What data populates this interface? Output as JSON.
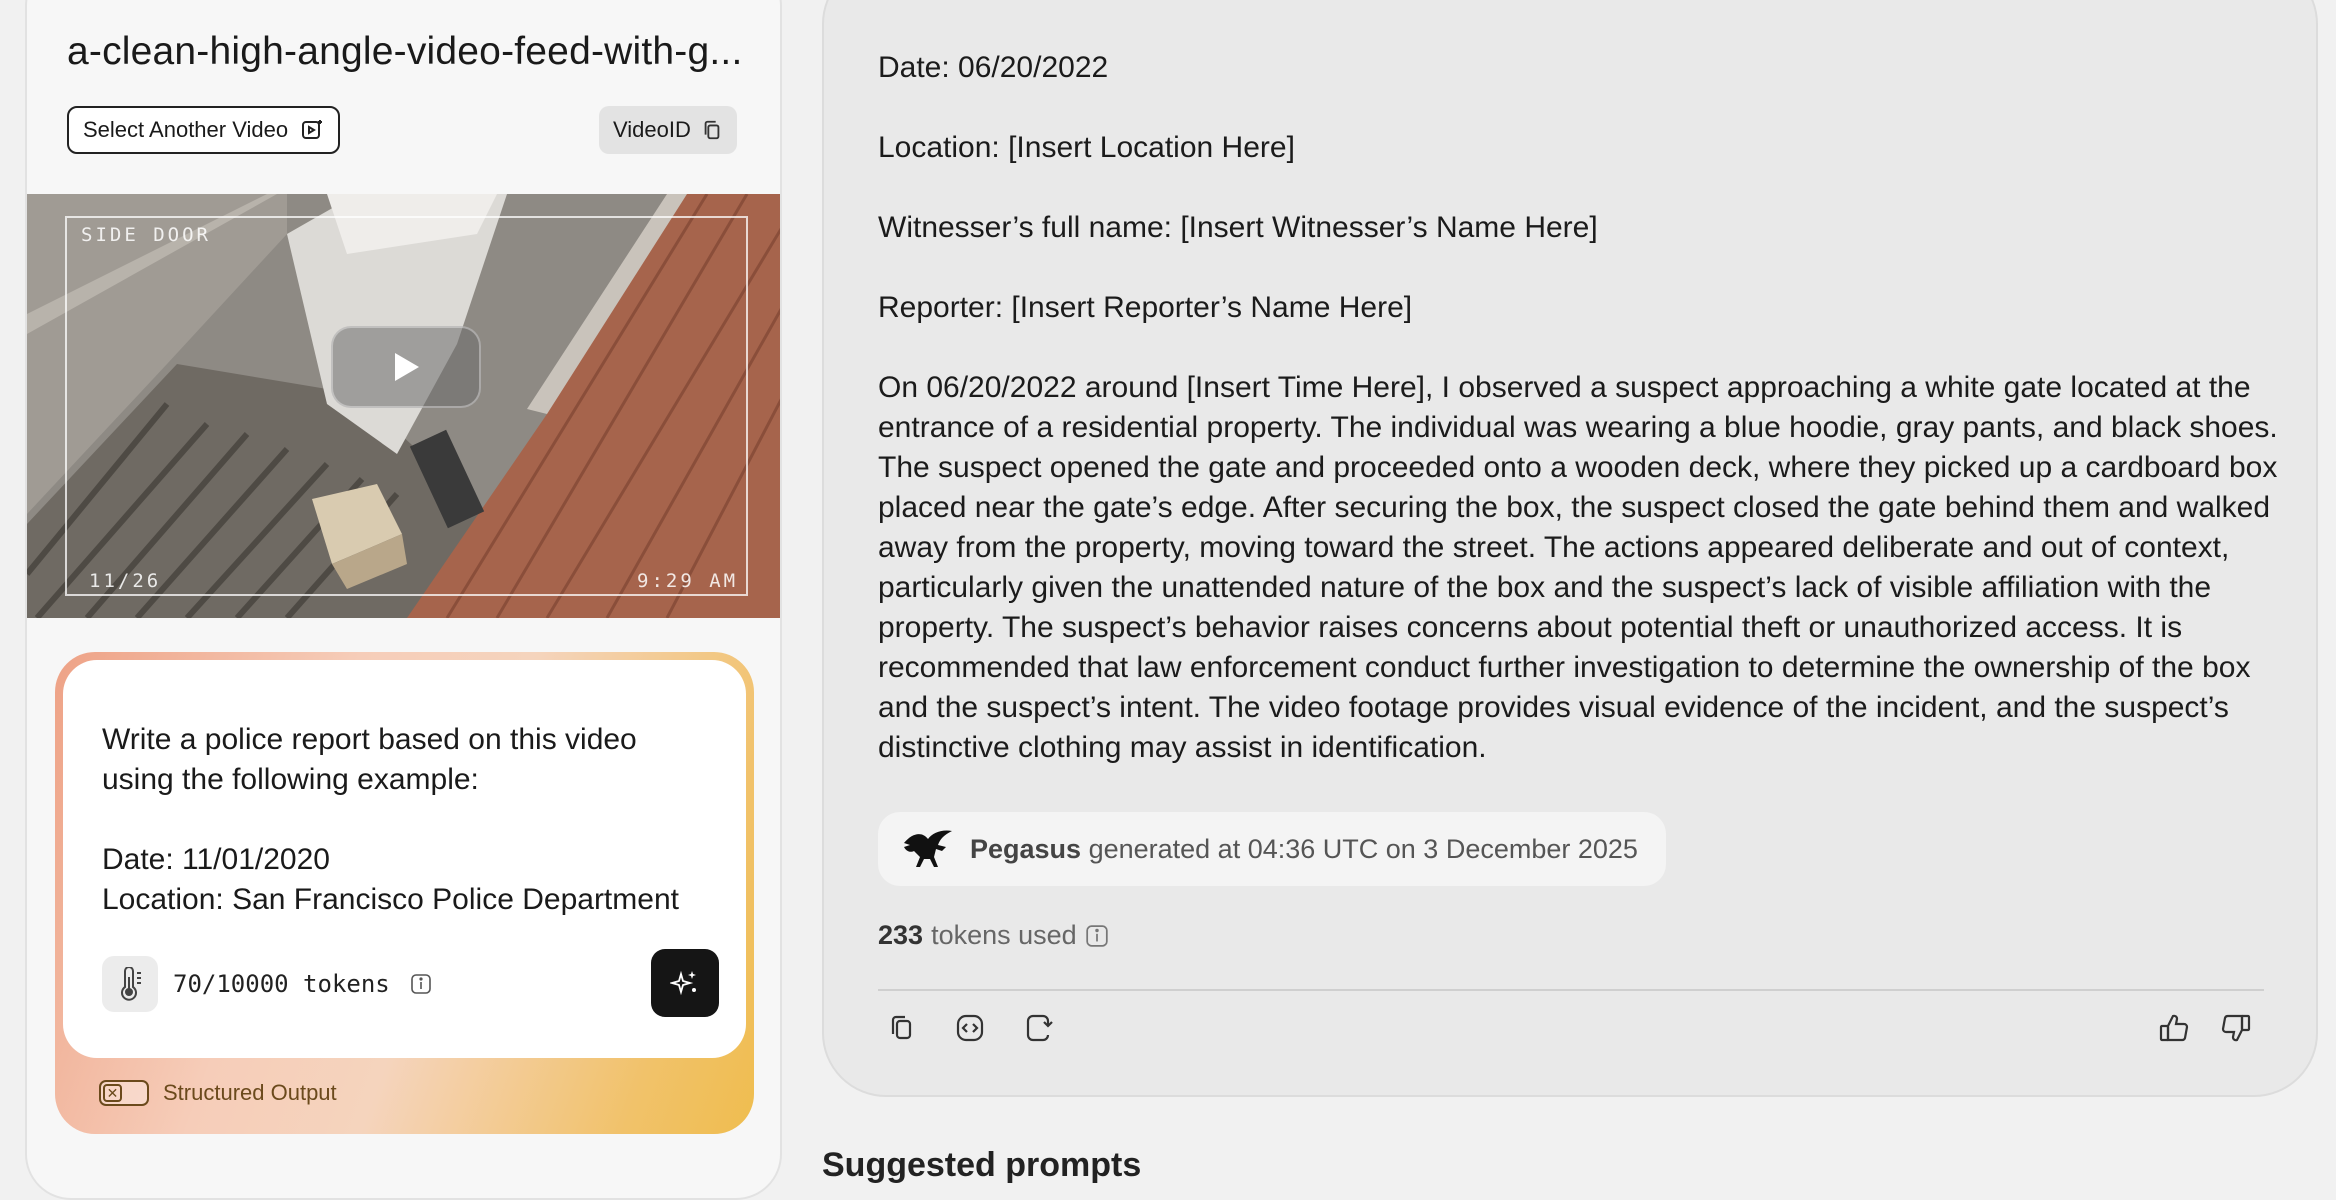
{
  "video_panel": {
    "title": "a-clean-high-angle-video-feed-with-g...",
    "select_button": "Select Another Video",
    "video_id_button": "VideoID",
    "overlay": {
      "camera_label": "SIDE DOOR",
      "date": "11/26",
      "time": "9:29 AM"
    }
  },
  "prompt": {
    "text": "Write a police report based on this video using the following example:\n\nDate: 11/01/2020\nLocation: San Francisco Police Department",
    "token_count": "70/10000 tokens",
    "structured_output_label": "Structured Output"
  },
  "response": {
    "date_line": "Date: 06/20/2022",
    "location_line": "Location: [Insert Location Here]",
    "witness_line": "Witnesser’s full name: [Insert Witnesser’s Name Here]",
    "reporter_line": "Reporter: [Insert Reporter’s Name Here]",
    "body": "On 06/20/2022 around [Insert Time Here], I observed a suspect approaching a white gate located at the entrance of a residential property. The individual was wearing a blue hoodie, gray pants, and black shoes. The suspect opened the gate and proceeded onto a wooden deck, where they picked up a cardboard box placed near the gate’s edge. After securing the box, the suspect closed the gate behind them and walked away from the property, moving toward the street. The actions appeared deliberate and out of context, particularly given the unattended nature of the box and the suspect’s lack of visible affiliation with the property. The suspect’s behavior raises concerns about potential theft or unauthorized access. It is recommended that law enforcement conduct further investigation to determine the ownership of the box and the suspect’s intent. The video footage provides visual evidence of the incident, and the suspect’s distinctive clothing may assist in identification.",
    "model_name": "Pegasus",
    "generated_text": "generated at 04:36 UTC on 3 December 2025",
    "tokens_used_count": "233",
    "tokens_used_label": "tokens used"
  },
  "footer": {
    "partial_heading": "Suggested prompts"
  },
  "icons": {
    "select_video": "video-select-icon",
    "copy_id": "copy-icon",
    "play": "play-icon",
    "thermometer": "thermometer-icon",
    "info": "info-icon",
    "send": "sparkle-icon",
    "model_logo": "pegasus-logo-icon",
    "actions": [
      "copy-icon",
      "code-icon",
      "regenerate-icon",
      "thumbs-up-icon",
      "thumbs-down-icon"
    ]
  },
  "colors": {
    "gradient_start": "#eea286",
    "gradient_end": "#efbd4f",
    "structured_label": "#6b4a1c",
    "send_button": "#151515"
  }
}
